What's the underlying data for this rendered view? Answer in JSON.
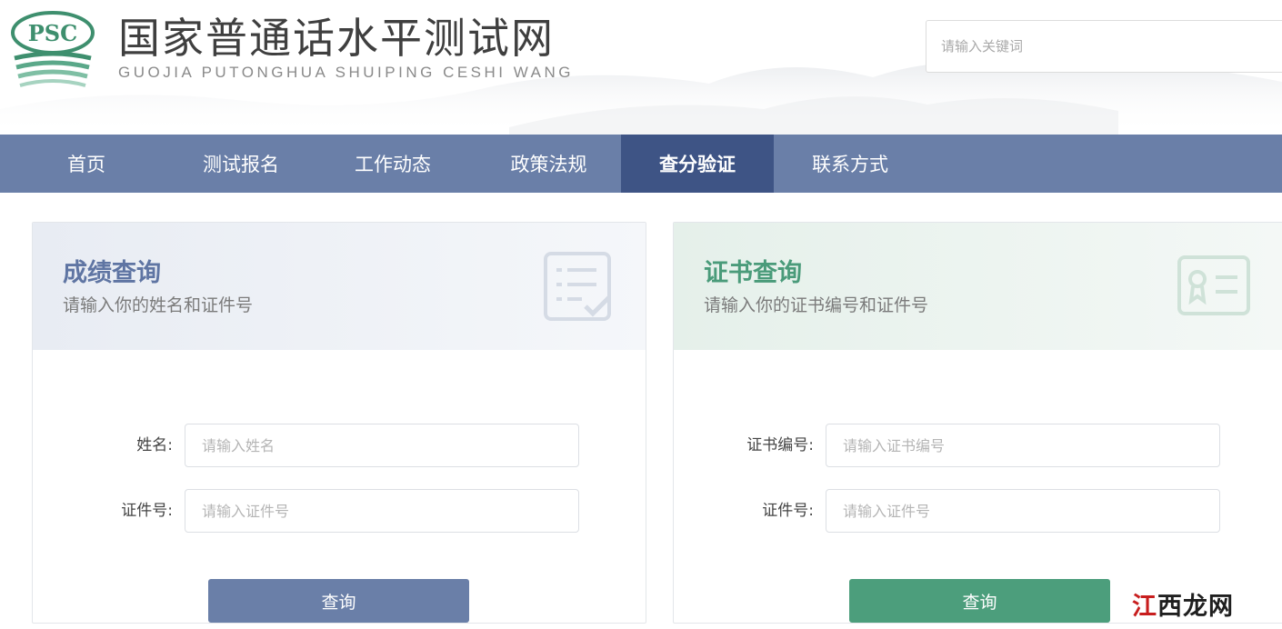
{
  "header": {
    "logo_text": "PSC",
    "site_title": "国家普通话水平测试网",
    "site_subtitle": "GUOJIA PUTONGHUA SHUIPING CESHI WANG",
    "search_placeholder": "请输入关键词"
  },
  "nav": {
    "items": [
      {
        "label": "首页"
      },
      {
        "label": "测试报名"
      },
      {
        "label": "工作动态"
      },
      {
        "label": "政策法规"
      },
      {
        "label": "查分验证",
        "active": true
      },
      {
        "label": "联系方式"
      }
    ]
  },
  "score_query": {
    "title": "成绩查询",
    "description": "请输入你的姓名和证件号",
    "name_label": "姓名:",
    "name_placeholder": "请输入姓名",
    "id_label": "证件号:",
    "id_placeholder": "请输入证件号",
    "submit_label": "查询",
    "icon": "checklist-icon"
  },
  "certificate_query": {
    "title": "证书查询",
    "description": "请输入你的证书编号和证件号",
    "cert_label": "证书编号:",
    "cert_placeholder": "请输入证书编号",
    "id_label": "证件号:",
    "id_placeholder": "请输入证件号",
    "submit_label": "查询",
    "icon": "certificate-icon"
  },
  "watermark": {
    "text": "江西龙网"
  },
  "colors": {
    "nav_bg": "#6a7fa8",
    "nav_active_bg": "#3e5485",
    "score_accent": "#5f75a3",
    "certificate_accent": "#4a9b7a",
    "score_button": "#6a7fa8",
    "certificate_button": "#4c9e7c",
    "logo_green": "#3e8f6e"
  }
}
